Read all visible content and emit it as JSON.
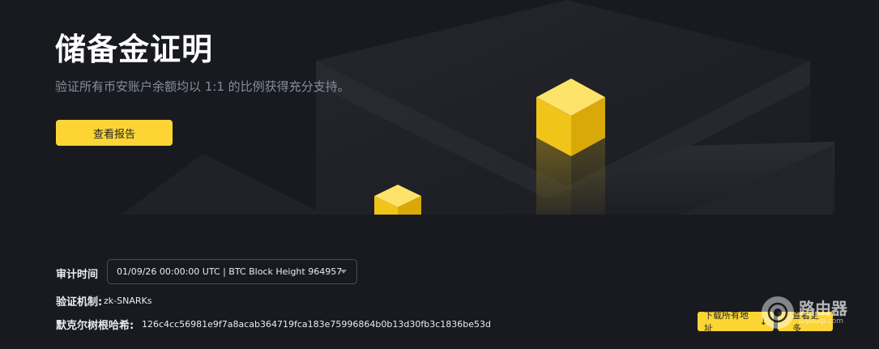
{
  "hero": {
    "title": "储备金证明",
    "subtitle": "验证所有币安账户余额均以 1:1 的比例获得充分支持。",
    "report_button": "查看报告"
  },
  "audit": {
    "label": "审计时间",
    "selected": "01/09/26 00:00:00 UTC | BTC Block Height 964957"
  },
  "mechanism": {
    "label": "验证机制:",
    "value": "zk-SNARKs"
  },
  "merkle": {
    "label": "默克尔树根哈希:",
    "value": "126c4cc56981e9f7a8acab364719fca183e75996864b0b13d30fb3c1836be53d"
  },
  "actions": {
    "download": "下载所有地址",
    "learn_more": "查看更多"
  },
  "watermark": {
    "cn": "路由器",
    "url": "luyouqi.com"
  },
  "colors": {
    "brand_yellow": "#fcd535",
    "background": "#181a20",
    "muted_text": "#848e9c"
  }
}
